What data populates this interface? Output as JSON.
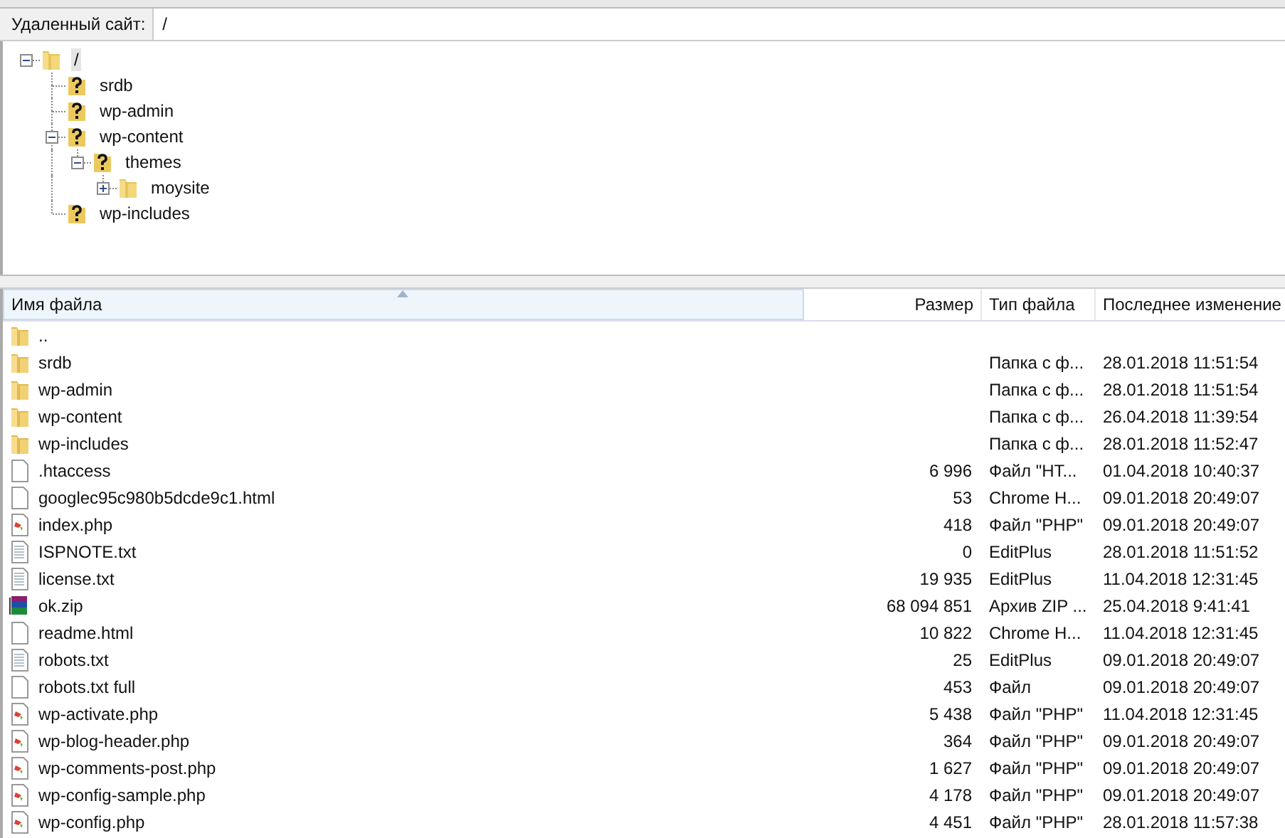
{
  "remote_site": {
    "label": "Удаленный сайт:",
    "path": "/"
  },
  "tree": [
    {
      "name": "/",
      "kind": "folder",
      "selected": true,
      "has_children": true,
      "expanded": true,
      "children": [
        {
          "name": "srdb",
          "kind": "unknown",
          "selected": false,
          "has_children": false
        },
        {
          "name": "wp-admin",
          "kind": "unknown",
          "selected": false,
          "has_children": false
        },
        {
          "name": "wp-content",
          "kind": "unknown",
          "selected": false,
          "has_children": true,
          "expanded": true,
          "children": [
            {
              "name": "themes",
              "kind": "unknown",
              "selected": false,
              "has_children": true,
              "expanded": true,
              "children": [
                {
                  "name": "moysite",
                  "kind": "folder",
                  "selected": false,
                  "has_children": true,
                  "expanded": false
                }
              ]
            }
          ]
        },
        {
          "name": "wp-includes",
          "kind": "unknown",
          "selected": false,
          "has_children": false
        }
      ]
    }
  ],
  "table": {
    "columns": [
      {
        "label": "Имя файла",
        "sorted": true
      },
      {
        "label": "Размер",
        "sorted": false
      },
      {
        "label": "Тип файла",
        "sorted": false
      },
      {
        "label": "Последнее изменение",
        "sorted": false
      }
    ],
    "rows": [
      {
        "kind": "folder",
        "name": "..",
        "size": "",
        "type": "",
        "modified": ""
      },
      {
        "kind": "folder",
        "name": "srdb",
        "size": "",
        "type": "Папка с ф...",
        "modified": "28.01.2018 11:51:54"
      },
      {
        "kind": "folder",
        "name": "wp-admin",
        "size": "",
        "type": "Папка с ф...",
        "modified": "28.01.2018 11:51:54"
      },
      {
        "kind": "folder",
        "name": "wp-content",
        "size": "",
        "type": "Папка с ф...",
        "modified": "26.04.2018 11:39:54"
      },
      {
        "kind": "folder",
        "name": "wp-includes",
        "size": "",
        "type": "Папка с ф...",
        "modified": "28.01.2018 11:52:47"
      },
      {
        "kind": "file",
        "name": ".htaccess",
        "size": "6 996",
        "type": "Файл \"HT...",
        "modified": "01.04.2018 10:40:37"
      },
      {
        "kind": "file",
        "name": "googlec95c980b5dcde9c1.html",
        "size": "53",
        "type": "Chrome H...",
        "modified": "09.01.2018 20:49:07"
      },
      {
        "kind": "php",
        "name": "index.php",
        "size": "418",
        "type": "Файл \"PHP\"",
        "modified": "09.01.2018 20:49:07"
      },
      {
        "kind": "text",
        "name": "ISPNOTE.txt",
        "size": "0",
        "type": "EditPlus",
        "modified": "28.01.2018 11:51:52"
      },
      {
        "kind": "text",
        "name": "license.txt",
        "size": "19 935",
        "type": "EditPlus",
        "modified": "11.04.2018 12:31:45"
      },
      {
        "kind": "archive",
        "name": "ok.zip",
        "size": "68 094 851",
        "type": "Архив ZIP ...",
        "modified": "25.04.2018 9:41:41"
      },
      {
        "kind": "file",
        "name": "readme.html",
        "size": "10 822",
        "type": "Chrome H...",
        "modified": "11.04.2018 12:31:45"
      },
      {
        "kind": "text",
        "name": "robots.txt",
        "size": "25",
        "type": "EditPlus",
        "modified": "09.01.2018 20:49:07"
      },
      {
        "kind": "file",
        "name": "robots.txt full",
        "size": "453",
        "type": "Файл",
        "modified": "09.01.2018 20:49:07"
      },
      {
        "kind": "php",
        "name": "wp-activate.php",
        "size": "5 438",
        "type": "Файл \"PHP\"",
        "modified": "11.04.2018 12:31:45"
      },
      {
        "kind": "php",
        "name": "wp-blog-header.php",
        "size": "364",
        "type": "Файл \"PHP\"",
        "modified": "09.01.2018 20:49:07"
      },
      {
        "kind": "php",
        "name": "wp-comments-post.php",
        "size": "1 627",
        "type": "Файл \"PHP\"",
        "modified": "09.01.2018 20:49:07"
      },
      {
        "kind": "php",
        "name": "wp-config-sample.php",
        "size": "4 178",
        "type": "Файл \"PHP\"",
        "modified": "09.01.2018 20:49:07"
      },
      {
        "kind": "php",
        "name": "wp-config.php",
        "size": "4 451",
        "type": "Файл \"PHP\"",
        "modified": "28.01.2018 11:57:38"
      }
    ]
  }
}
